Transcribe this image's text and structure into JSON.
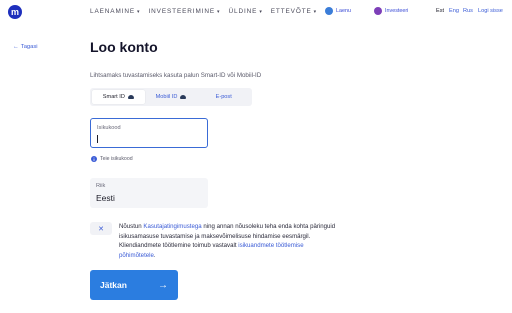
{
  "header": {
    "logo_letter": "m",
    "nav": [
      {
        "label": "LAENAMINE"
      },
      {
        "label": "INVESTEERIMINE"
      },
      {
        "label": "ÜLDINE"
      },
      {
        "label": "ETTEVÕTE"
      }
    ],
    "pills": {
      "laenu": "Laenu",
      "invest": "Investeeri"
    },
    "languages": {
      "est": "Est",
      "eng": "Eng",
      "rus": "Rus"
    },
    "logout": "Logi sisse"
  },
  "back_label": "Tagasi",
  "page_title": "Loo konto",
  "subtitle": "Lihtsamaks tuvastamiseks kasuta palun Smart-ID või Mobiil-ID",
  "tabs": [
    {
      "label": "Smart ID",
      "active": true
    },
    {
      "label": "Mobiil ID",
      "active": false
    },
    {
      "label": "E-post",
      "active": false
    }
  ],
  "id_field": {
    "label": "Isikukood",
    "value": ""
  },
  "hint": "Teie isikukood",
  "country": {
    "label": "Riik",
    "value": "Eesti"
  },
  "consent": {
    "checkbox_mark": "✕",
    "text1": "Nõustun ",
    "link1": "Kasutajatingimustega",
    "text2": " ning annan nõusoleku teha enda kohta päringuid isikusamasuse tuvastamise ja maksevõimelisuse hindamise eesmärgil. Kliendiandmete töötlemine toimub vastavalt ",
    "link2": "isikuandmete töötlemise põhimõtetele",
    "text3": "."
  },
  "submit": {
    "label": "Jätkan",
    "arrow": "→"
  }
}
